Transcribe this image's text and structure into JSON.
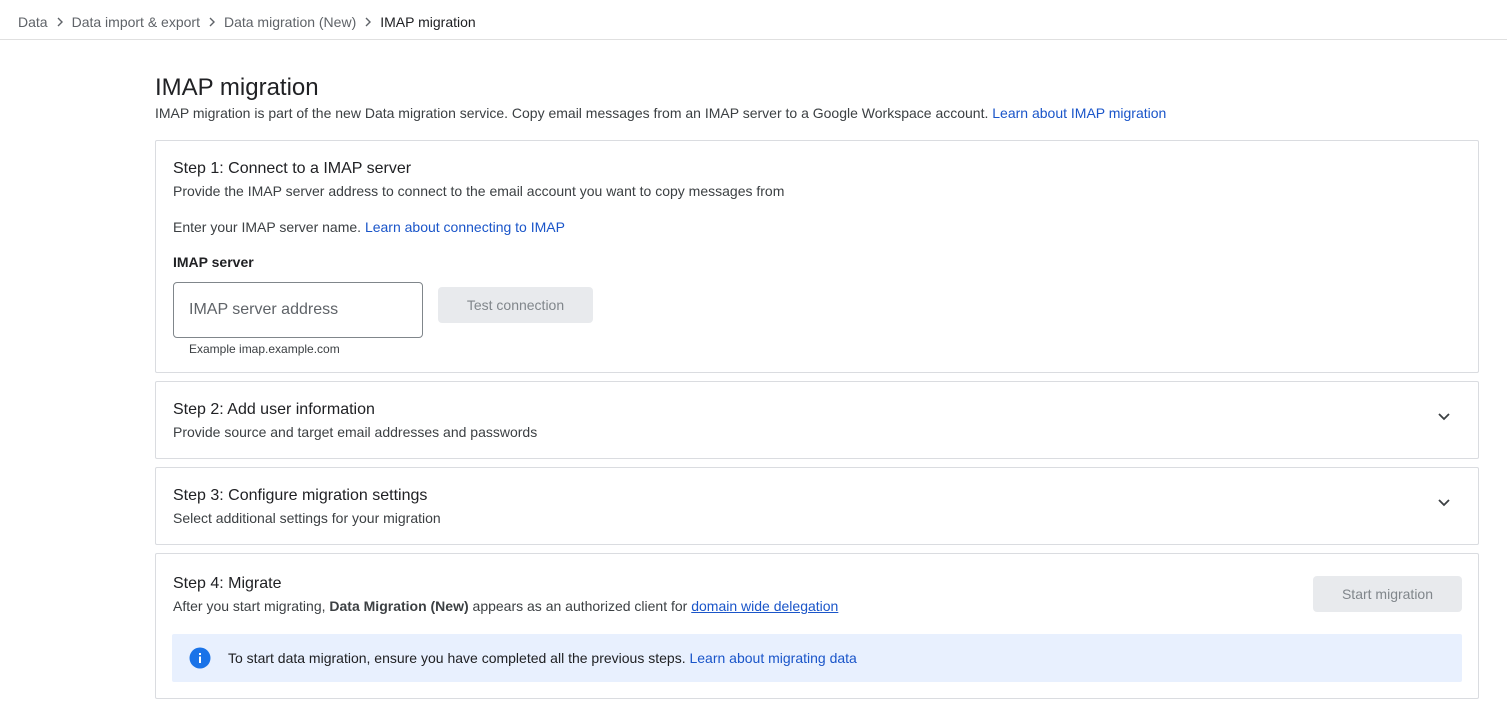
{
  "breadcrumb": {
    "items": [
      "Data",
      "Data import & export",
      "Data migration (New)"
    ],
    "current": "IMAP migration"
  },
  "header": {
    "title": "IMAP migration",
    "description": "IMAP migration is part of the new Data migration service. Copy email messages from an IMAP server to a Google Workspace account.",
    "learn_link": "Learn about IMAP migration"
  },
  "step1": {
    "title": "Step 1: Connect to a IMAP server",
    "subtitle": "Provide the IMAP server address to connect to the email account you want to copy messages from",
    "prompt": "Enter your IMAP server name.",
    "prompt_link": "Learn about connecting to IMAP",
    "field_label": "IMAP server",
    "input_placeholder": "IMAP server address",
    "input_value": "",
    "helper": "Example imap.example.com",
    "test_button": "Test connection"
  },
  "step2": {
    "title": "Step 2: Add user information",
    "subtitle": "Provide source and target email addresses and passwords",
    "icon": "chevron-down-icon"
  },
  "step3": {
    "title": "Step 3: Configure migration settings",
    "subtitle": "Select additional settings for your migration",
    "icon": "chevron-down-icon"
  },
  "step4": {
    "title": "Step 4: Migrate",
    "subtitle_prefix": "After you start migrating,",
    "subtitle_bold": "Data Migration (New)",
    "subtitle_middle": "appears as an authorized client for",
    "subtitle_link": "domain wide delegation",
    "start_button": "Start migration",
    "info_text": "To start data migration, ensure you have completed all the previous steps.",
    "info_link": "Learn about migrating data",
    "info_icon": "info-icon"
  },
  "colors": {
    "link": "#1a55c9",
    "info_bg": "#e8f0fe",
    "info_icon": "#1a73e8",
    "disabled_bg": "#e8eaed",
    "disabled_text": "#80868b",
    "border": "#dadce0"
  }
}
